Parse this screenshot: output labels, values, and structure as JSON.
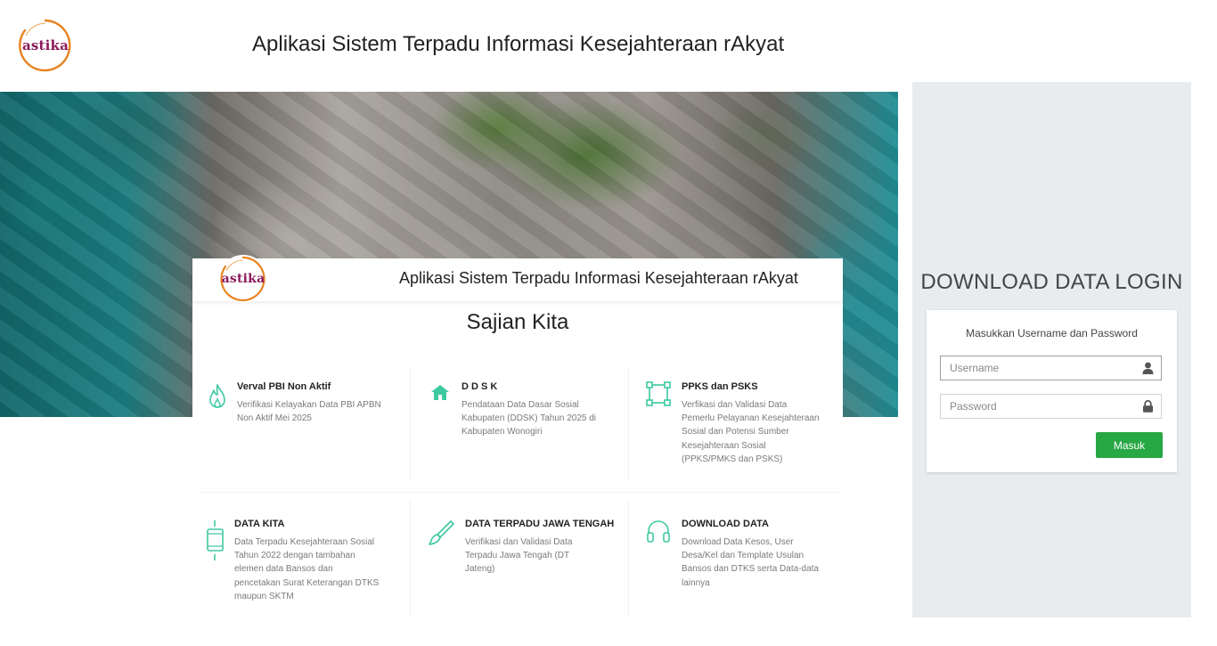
{
  "header": {
    "logo_text": "astika",
    "title": "Aplikasi Sistem Terpadu Informasi Kesejahteraan rAkyat"
  },
  "panel": {
    "logo_text": "astika",
    "title": "Aplikasi Sistem Terpadu Informasi Kesejahteraan rAkyat",
    "heading": "Sajian Kita",
    "cards": [
      {
        "title": "Verval PBI Non Aktif",
        "icon": "fire-icon",
        "lines": [
          "Verifikasi Kelayakan Data PBI APBN",
          "Non Aktif Mei 2025"
        ]
      },
      {
        "title": "D D S K",
        "icon": "home-icon",
        "lines": [
          "Pendataan Data Dasar Sosial",
          "Kabupaten (DDSK) Tahun 2025 di",
          "Kabupaten Wonogiri"
        ]
      },
      {
        "title": "PPKS dan PSKS",
        "icon": "vector-square-icon",
        "lines": [
          "Verfikasi dan Validasi Data",
          "Pemerlu Pelayanan Kesejahteraan",
          "Sosial dan Potensi Sumber",
          "Kesejahteraan Sosial",
          "(PPKS/PMKS dan PSKS)"
        ]
      },
      {
        "title": "DATA KITA",
        "icon": "tablet-icon",
        "lines": [
          "Data Terpadu Kesejahteraan Sosial",
          "Tahun 2022 dengan tambahan",
          "elemen data Bansos dan",
          "pencetakan Surat Keterangan DTKS",
          "maupun SKTM"
        ]
      },
      {
        "title": "DATA TERPADU JAWA TENGAH",
        "icon": "brush-icon",
        "lines": [
          "Verifikasi dan Validasi Data",
          "Terpadu Jawa Tengah (DT",
          "Jateng)"
        ]
      },
      {
        "title": "DOWNLOAD DATA",
        "icon": "headphones-icon",
        "lines": [
          "Download Data Kesos, User",
          "Desa/Kel dan Template Usulan",
          "Bansos dan DTKS serta Data-data",
          "lainnya"
        ]
      }
    ]
  },
  "login": {
    "title": "DOWNLOAD DATA LOGIN",
    "message": "Masukkan Username dan Password",
    "username_placeholder": "Username",
    "password_placeholder": "Password",
    "submit_label": "Masuk"
  },
  "colors": {
    "accent": "#28a745",
    "icon_teal": "#3cc9a0",
    "logo_text": "#8a1a5a",
    "logo_ring": "#e8821e",
    "login_bg": "#e9ecef"
  }
}
